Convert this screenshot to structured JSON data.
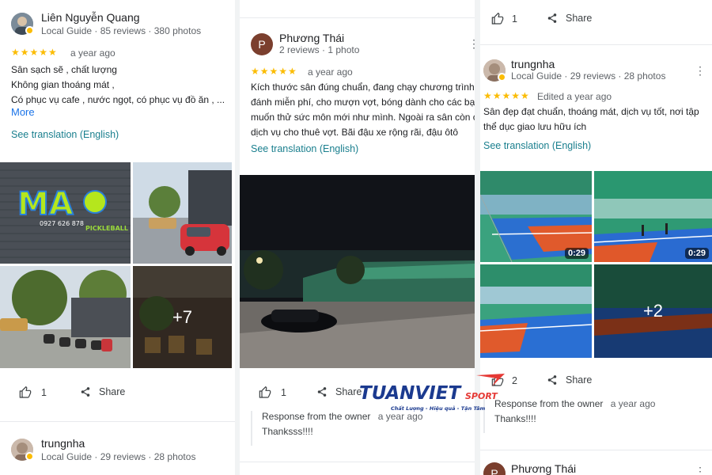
{
  "col1": {
    "review1": {
      "author": "Liên Nguyễn Quang",
      "meta": "Local Guide · 85 reviews · 380 photos",
      "stars": "★★★★★",
      "date": "a year ago",
      "lines": [
        "Sân sạch sẽ , chất lượng",
        "Không gian thoáng mát ,",
        "Có phục vụ cafe , nước ngọt, có phục vụ đồ ăn , ..."
      ],
      "more": "More",
      "translate": "See translation (English)",
      "photo_more": "+7",
      "likes": "1",
      "share": "Share"
    },
    "review2": {
      "author": "trungnha",
      "meta": "Local Guide · 29 reviews · 28 photos"
    }
  },
  "col2": {
    "review": {
      "author": "Phương Thái",
      "initial": "P",
      "meta": "2 reviews · 1 photo",
      "stars": "★★★★★",
      "date": "a year ago",
      "lines": [
        "Kích thước sân đúng chuẩn, đang chạy chương trình",
        "đánh miễn phí, cho mượn vợt, bóng dành cho các bạn",
        "muốn thử sức môn mới như mình. Ngoài ra sân còn có",
        "dịch vụ cho thuê vợt. Bãi đậu xe rộng rãi, đậu ôtô"
      ],
      "translate": "See translation (English)",
      "likes": "1",
      "share": "Share",
      "response_title": "Response from the owner",
      "response_date": "a year ago",
      "response_text": "Thanksss!!!!"
    }
  },
  "col3": {
    "top": {
      "likes": "1",
      "share": "Share"
    },
    "review": {
      "author": "trungnha",
      "meta": "Local Guide · 29 reviews · 28 photos",
      "stars": "★★★★★",
      "date": "Edited a year ago",
      "lines": [
        "Sân đẹp đạt chuẩn, thoáng mát, dịch vụ tốt, nơi tập",
        "thể dục giao lưu hữu ích"
      ],
      "translate": "See translation (English)",
      "video1": "0:29",
      "video2": "0:29",
      "photo_more": "+2",
      "likes": "2",
      "share": "Share",
      "response_title": "Response from the owner",
      "response_date": "a year ago",
      "response_text": "Thanks!!!!"
    },
    "next": {
      "author": "Phương Thái",
      "initial": "P"
    }
  },
  "logo": {
    "brand": "TUANVIET",
    "sub": "SPORT",
    "tagline": "Chất Lượng - Hiệu quả - Tận Tâm"
  },
  "colors": {
    "star": "#fbbc04",
    "link": "#1a7f8e",
    "brand_blue": "#1b3a8f",
    "brand_red": "#e53935"
  }
}
